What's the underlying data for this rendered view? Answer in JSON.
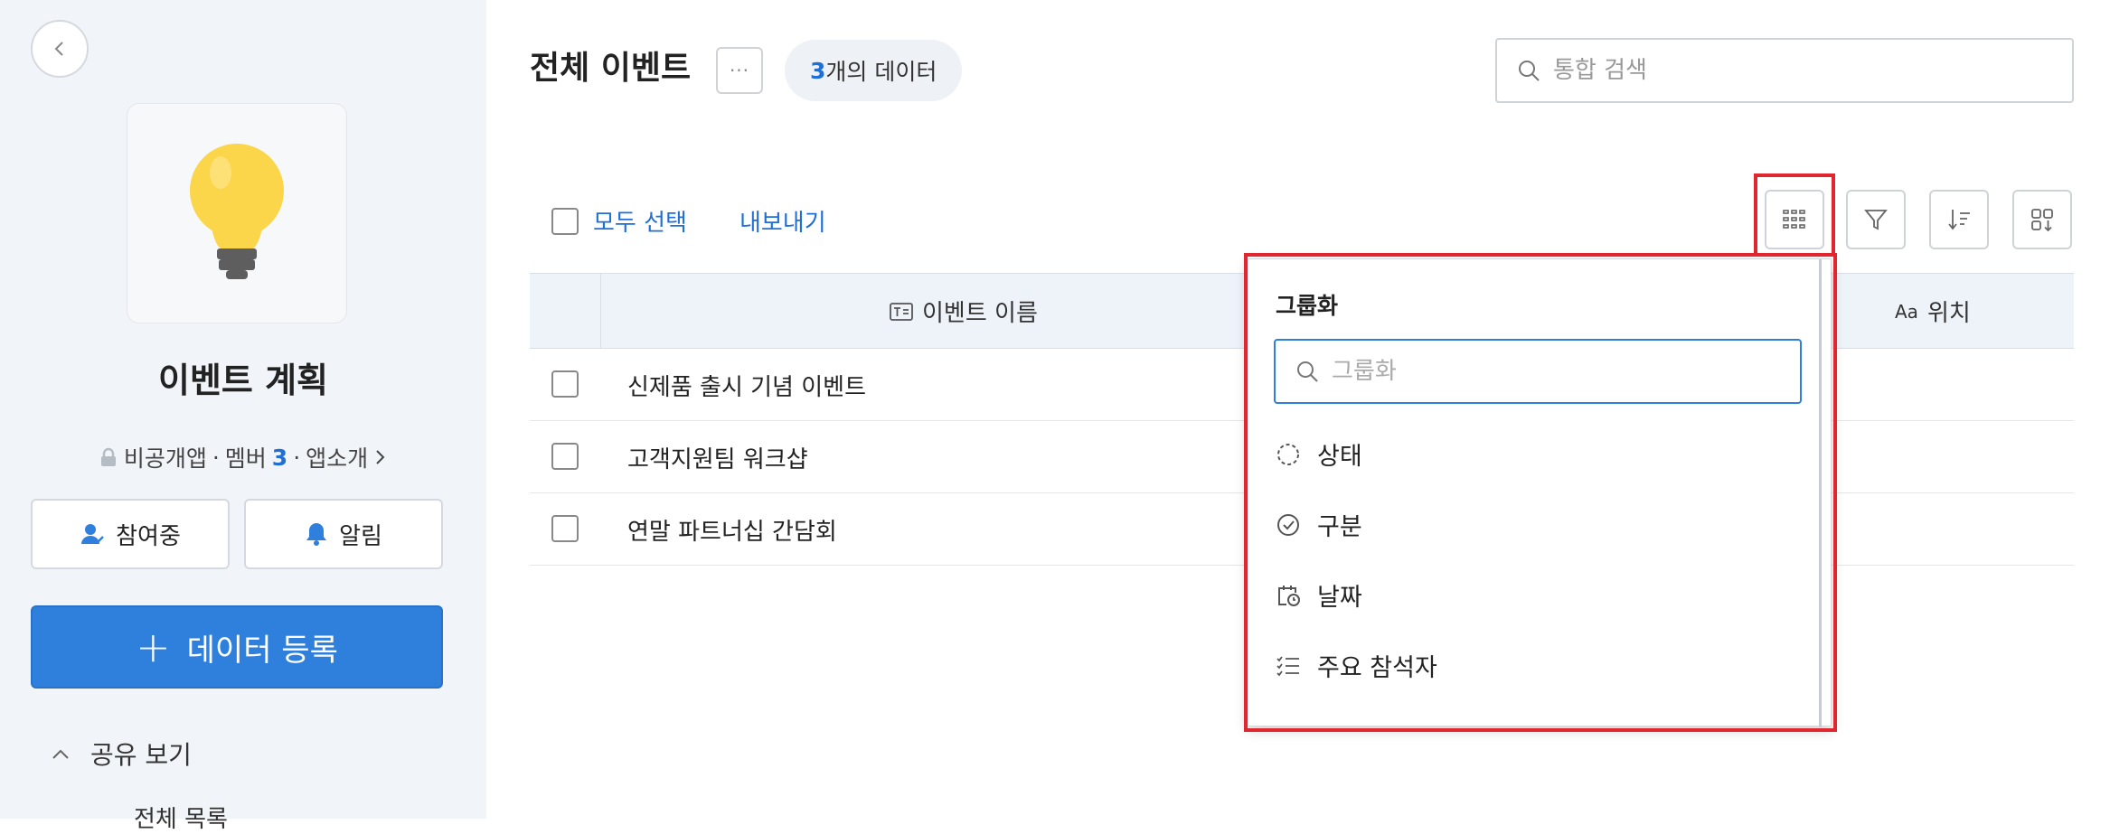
{
  "sidebar": {
    "app_title": "이벤트 계획",
    "meta": {
      "visibility": "비공개앱",
      "members_label": "멤버",
      "members_count": "3",
      "intro": "앱소개"
    },
    "join_label": "참여중",
    "notify_label": "알림",
    "register_label": "데이터 등록",
    "shared_view_label": "공유 보기",
    "partial_item": "전체 목록"
  },
  "header": {
    "title": "전체 이벤트",
    "more": "···",
    "count_num": "3",
    "count_suffix": "개의 데이터",
    "search_placeholder": "통합 검색"
  },
  "toolbar": {
    "select_all": "모두 선택",
    "export": "내보내기"
  },
  "table": {
    "columns": {
      "name": "이벤트 이름",
      "location": "위치"
    },
    "rows": [
      {
        "name": "신제품 출시 기념 이벤트"
      },
      {
        "name": "고객지원팀 워크샵"
      },
      {
        "name": "연말 파트너십 간담회"
      }
    ]
  },
  "group_menu": {
    "title": "그룹화",
    "search_placeholder": "그룹화",
    "items": [
      "상태",
      "구분",
      "날짜",
      "주요 참석자"
    ]
  },
  "colors": {
    "accent": "#2f80dd",
    "highlight": "#e0262e",
    "sidebar_bg": "#f1f4f8"
  }
}
